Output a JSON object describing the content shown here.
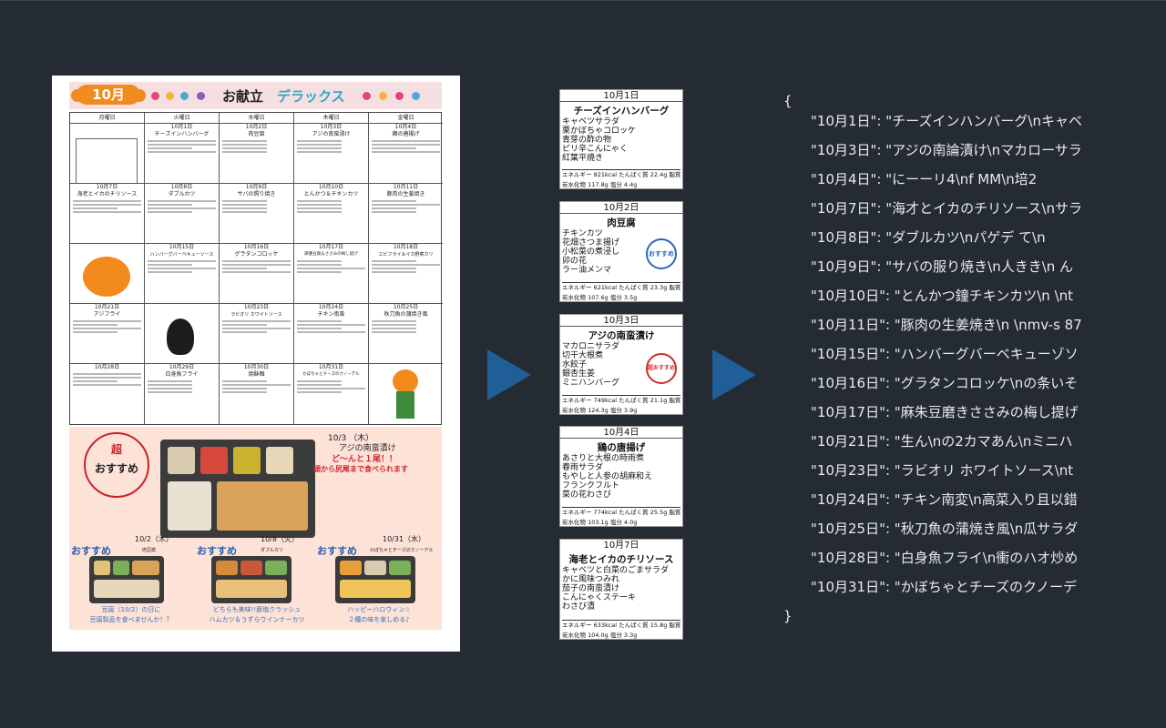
{
  "menu": {
    "month_label": "10月",
    "title_main": "お献立",
    "title_deluxe": "デラックス",
    "weekdays": [
      "月曜日",
      "火曜日",
      "水曜日",
      "木曜日",
      "金曜日"
    ],
    "cells": [
      {
        "date": "10月1日",
        "name": "チーズインハンバーグ"
      },
      {
        "date": "10月2日",
        "name": "肉豆腐"
      },
      {
        "date": "10月3日",
        "name": "アジの南蛮漬け"
      },
      {
        "date": "10月4日",
        "name": "鶏の唐揚げ"
      },
      {
        "date": "10月7日",
        "name": "海老とイカのチリソース"
      },
      {
        "date": "10月8日",
        "name": "ダブルカツ"
      },
      {
        "date": "10月9日",
        "name": "サバの照り焼き"
      },
      {
        "date": "10月10日",
        "name": "とんかつ＆チキンカツ"
      },
      {
        "date": "10月11日",
        "name": "豚肉の生姜焼き"
      },
      {
        "date": "10月15日",
        "name": "ハンバーグバーベキューソース"
      },
      {
        "date": "10月16日",
        "name": "グラタンコロッケ"
      },
      {
        "date": "10月17日",
        "name": "麻婆豆腐＆ささみの梅し提げ"
      },
      {
        "date": "10月18日",
        "name": "エビフライ＆イカ野菜カツ"
      },
      {
        "date": "10月21日",
        "name": "アジフライ"
      },
      {
        "date": "10月23日",
        "name": "ラビオリ ホワイトソース"
      },
      {
        "date": "10月24日",
        "name": "チキン南蛮"
      },
      {
        "date": "10月25日",
        "name": "秋刀魚の蒲焼き風"
      },
      {
        "date": "10月28日",
        "name": "白身魚フライ"
      },
      {
        "date": "10月29日",
        "name": "白身魚フライ"
      },
      {
        "date": "10月30日",
        "name": "焼酥麺"
      },
      {
        "date": "10月31日",
        "name": "かぼちゃとチーズのクノーデル"
      }
    ],
    "promo": {
      "circle_top": "超",
      "circle_bottom": "おすすめ",
      "date": "10/3 （木）",
      "dish": "アジの南蛮漬け",
      "catch1": "ど～んと１尾！！",
      "catch2": "頭から尻尾まで食べられます",
      "minis": [
        {
          "date": "10/2（木）",
          "lead": "おすすめ",
          "name": "肉豆腐",
          "caption1": "豆腐（10/2）の日に",
          "caption2": "豆腐製品を食べませんか！？"
        },
        {
          "date": "10/8（火）",
          "lead": "おすすめ",
          "name": "ダブルカツ",
          "caption1": "どちらも美味!!豚塩クラッシュ",
          "caption2": "ハムカツ＆うずらウインナーカツ"
        },
        {
          "date": "10/31（木）",
          "lead": "おすすめ",
          "name": "かぼちゃとチーズのクノーデル",
          "caption1": "ハッピーハロウィン☆",
          "caption2": "２種の味を楽しめる♪"
        }
      ]
    }
  },
  "crops": [
    {
      "date": "10月1日",
      "name": "チーズインハンバーグ",
      "items": [
        "キャベツサラダ",
        "栗かぼちゃコロッケ",
        "青芽の酢の物",
        "ピリ辛こんにゃく",
        "紅葉平焼き"
      ],
      "note1": "エネルギー 821kcal たんぱく質 22.4g 脂質 26.8g",
      "note2": "炭水化物 117.8g 塩分 4.4g"
    },
    {
      "date": "10月2日",
      "name": "肉豆腐",
      "items": [
        "チキンカツ",
        "花畑さつま揚げ",
        "小松菜の煮浸し",
        "卯の花",
        "ラー油メンマ"
      ],
      "stamp": "おすすめ",
      "note1": "エネルギー 621kcal たんぱく質 23.3g 脂質 9.6g",
      "note2": "炭水化物 107.6g 塩分 3.5g"
    },
    {
      "date": "10月3日",
      "name": "アジの南蛮漬け",
      "items": [
        "マカロニサラダ",
        "切干大根煮",
        "水餃子",
        "銀杏生姜",
        "ミニハンバーグ"
      ],
      "stamp": "超おすすめ",
      "note1": "エネルギー 749kcal たんぱく質 21.1g 脂質 16.6g",
      "note2": "炭水化物 124.3g 塩分 3.9g"
    },
    {
      "date": "10月4日",
      "name": "鶏の唐揚げ",
      "items": [
        "あさりと大根の時雨煮",
        "春雨サラダ",
        "もやしと人参の胡麻和え",
        "フランクフルト",
        "菜の花わさび"
      ],
      "note1": "エネルギー 774kcal たんぱく質 25.5g 脂質 27.0g",
      "note2": "炭水化物 103.1g 塩分 4.0g"
    },
    {
      "date": "10月7日",
      "name": "海老とイカのチリソース",
      "items": [
        "キャベツと白菜のごまサラダ",
        "かに風味つみれ",
        "茄子の南蛮漬け",
        "こんにゃくステーキ",
        "わさび漬"
      ],
      "note1": "エネルギー 633kcal たんぱく質 15.8g 脂質 14.4g",
      "note2": "炭水化物 104.0g 塩分 3.3g"
    }
  ],
  "json_view": {
    "open_brace": "{",
    "close_brace": "}",
    "lines": [
      "\"10月1日\": \"チーズインハンバーグ\\nキャベ",
      "\"10月3日\": \"アジの南論漬け\\nマカローサラ",
      "\"10月4日\": \"にーーリ4\\nf          MM\\n培2",
      "\"10月7日\": \"海才とイカのチリソース\\nサラ",
      "\"10月8日\": \"ダブルカツ\\nパゲデ        て\\n",
      "\"10月9日\": \"サバの服り焼き\\n人きき\\n      ん",
      "\"10月10日\": \"とんかつ鐘チキンカツ\\n \\nt",
      "\"10月11日\": \"豚肉の生姜焼き\\n \\nmv-s 87",
      "\"10月15日\": \"ハンバーグバーベキューゾソ",
      "\"10月16日\": \"グラタンコロッケ\\nの条いそ",
      "\"10月17日\": \"麻朱豆磨きささみの梅し提げ",
      "\"10月21日\": \"生ん\\nの2カマあん\\nミニハ",
      "\"10月23日\": \"ラビオリ ホワイトソース\\nt",
      "\"10月24日\": \"チキン南変\\n高菜入り且以錯",
      "\"10月25日\": \"秋刀魚の蒲焼き風\\n瓜サラダ",
      "\"10月28日\": \"白身魚フライ\\n衝のハオ炒め",
      "\"10月31日\": \"かぼちゃとチーズのクノーデ"
    ]
  },
  "colors": {
    "background": "#252b33",
    "arrow": "#1f5e97",
    "json_text": "#e8eaed",
    "accent_orange": "#f08c1e",
    "accent_red": "#d1282f"
  }
}
